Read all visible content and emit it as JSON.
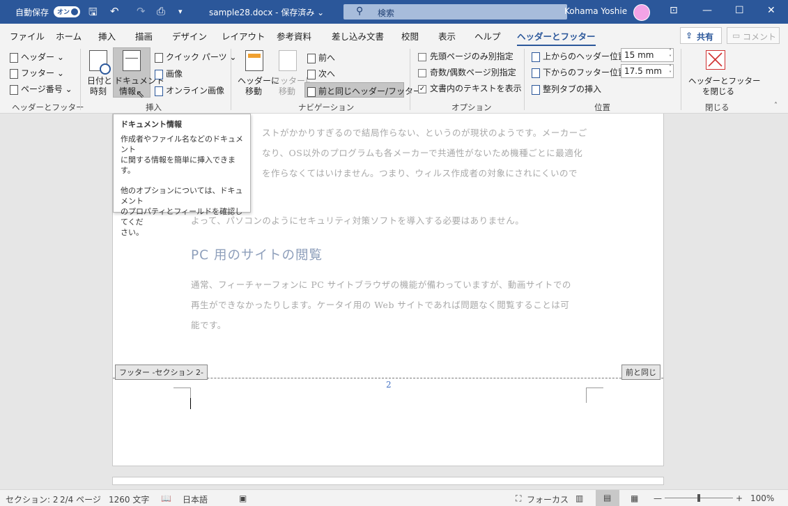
{
  "titlebar": {
    "autosave_label": "自動保存",
    "autosave_state": "オン",
    "doc_title": "sample28.docx - 保存済み ⌄",
    "search_placeholder": "検索",
    "user_name": "Kohama Yoshie",
    "accent_color": "#2b579a"
  },
  "tabs": [
    "ファイル",
    "ホーム",
    "挿入",
    "描画",
    "デザイン",
    "レイアウト",
    "参考資料",
    "差し込み文書",
    "校閲",
    "表示",
    "ヘルプ",
    "ヘッダーとフッター"
  ],
  "share_label": "共有",
  "comment_label": "コメント",
  "ribbon": {
    "hf_group": {
      "header": "ヘッダー",
      "footer": "フッター",
      "page_number": "ページ番号",
      "label": "ヘッダーとフッター"
    },
    "insert_group": {
      "date_time_1": "日付と",
      "date_time_2": "時刻",
      "doc_info_1": "ドキュメント",
      "doc_info_2": "情報",
      "quick_parts": "クイック パーツ",
      "image": "画像",
      "online_image": "オンライン画像",
      "label": "挿入"
    },
    "nav_group": {
      "goto_header_1": "ヘッダーに",
      "goto_header_2": "移動",
      "goto_footer_1": "フッターに",
      "goto_footer_2": "移動",
      "prev": "前へ",
      "next": "次へ",
      "link_previous": "前と同じヘッダー/フッター",
      "label": "ナビゲーション"
    },
    "options_group": {
      "first_page": "先頭ページのみ別指定",
      "odd_even": "奇数/偶数ページ別指定",
      "show_text": "文書内のテキストを表示",
      "label": "オプション"
    },
    "position_group": {
      "header_pos_label": "上からのヘッダー位置:",
      "header_pos_value": "15 mm",
      "footer_pos_label": "下からのフッター位置:",
      "footer_pos_value": "17.5 mm",
      "align_tab": "整列タブの挿入",
      "label": "位置"
    },
    "close_group": {
      "close_1": "ヘッダーとフッター",
      "close_2": "を閉じる",
      "label": "閉じる"
    }
  },
  "tooltip": {
    "title": "ドキュメント情報",
    "line1": "作成者やファイル名などのドキュメント",
    "line2": "に関する情報を簡単に挿入できま",
    "line3": "す。",
    "line4": "他のオプションについては、ドキュメント",
    "line5": "のプロパティとフィールドを確認してくだ",
    "line6": "さい。"
  },
  "document": {
    "p1_l1": "ストがかかりすぎるので結局作らない、というのが現状のようです。メーカーご",
    "p1_l2": "なり、OS以外のプログラムも各メーカーで共通性がないため機種ごとに最適化",
    "p1_l3": "を作らなくてはいけません。つまり、ウィルス作成者の対象にされにくいので",
    "p2": "よって、パソコンのようにセキュリティ対策ソフトを導入する必要はありません。",
    "heading": "PC 用のサイトの閲覧",
    "p3_l1": "通常、フィーチャーフォンに PC サイトブラウザの機能が備わっていますが、動画サイトでの",
    "p3_l2": "再生ができなかったりします。ケータイ用の Web サイトであれば問題なく閲覧することは可",
    "p3_l3": "能です。",
    "footer_tag": "フッター -セクション 2-",
    "same_as_prev": "前と同じ",
    "page_number": "2"
  },
  "status": {
    "section": "セクション: 2",
    "page": "2/4 ページ",
    "words": "1260 文字",
    "language": "日本語",
    "focus": "フォーカス",
    "zoom": "100%",
    "zoom_level": 0.5
  }
}
